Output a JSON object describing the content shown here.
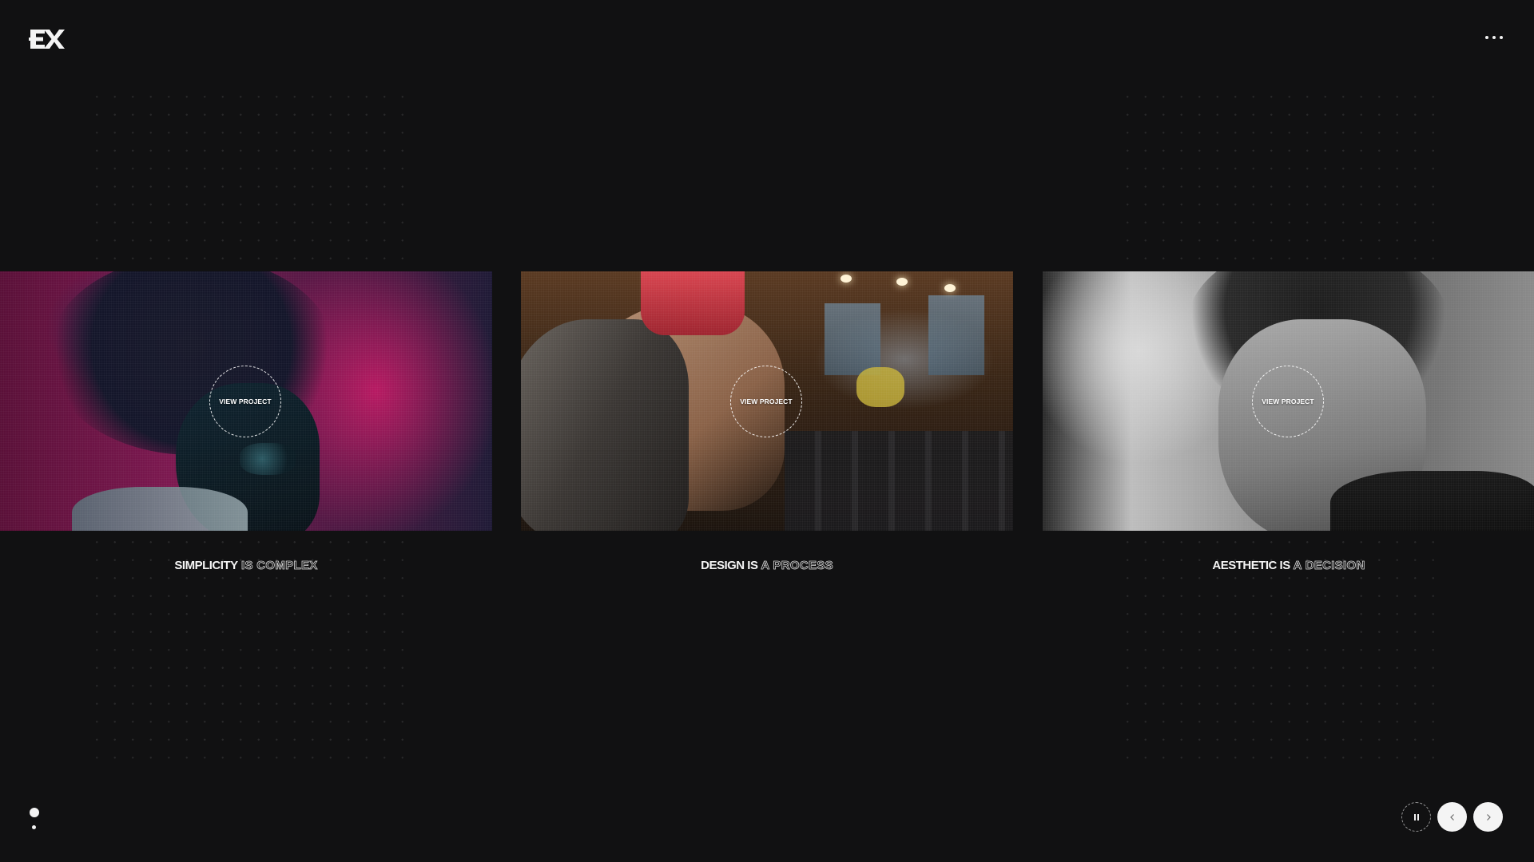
{
  "header": {
    "logo_icon": "ex-logo-icon",
    "menu_icon": "more-dots-icon"
  },
  "slides": [
    {
      "view_label": "VIEW PROJECT",
      "caption_solid": "SIMPLICITY",
      "caption_outline": " IS COMPLEX"
    },
    {
      "view_label": "VIEW PROJECT",
      "caption_solid": "DESIGN IS",
      "caption_outline": " A PROCESS"
    },
    {
      "view_label": "VIEW PROJECT",
      "caption_solid": "AESTHETIC IS",
      "caption_outline": " A DECISION"
    }
  ],
  "controls": {
    "pause_icon": "pause-icon",
    "prev_icon": "chevron-left-icon",
    "next_icon": "chevron-right-icon"
  },
  "colors": {
    "background": "#111112",
    "foreground": "#f4f4f4"
  }
}
